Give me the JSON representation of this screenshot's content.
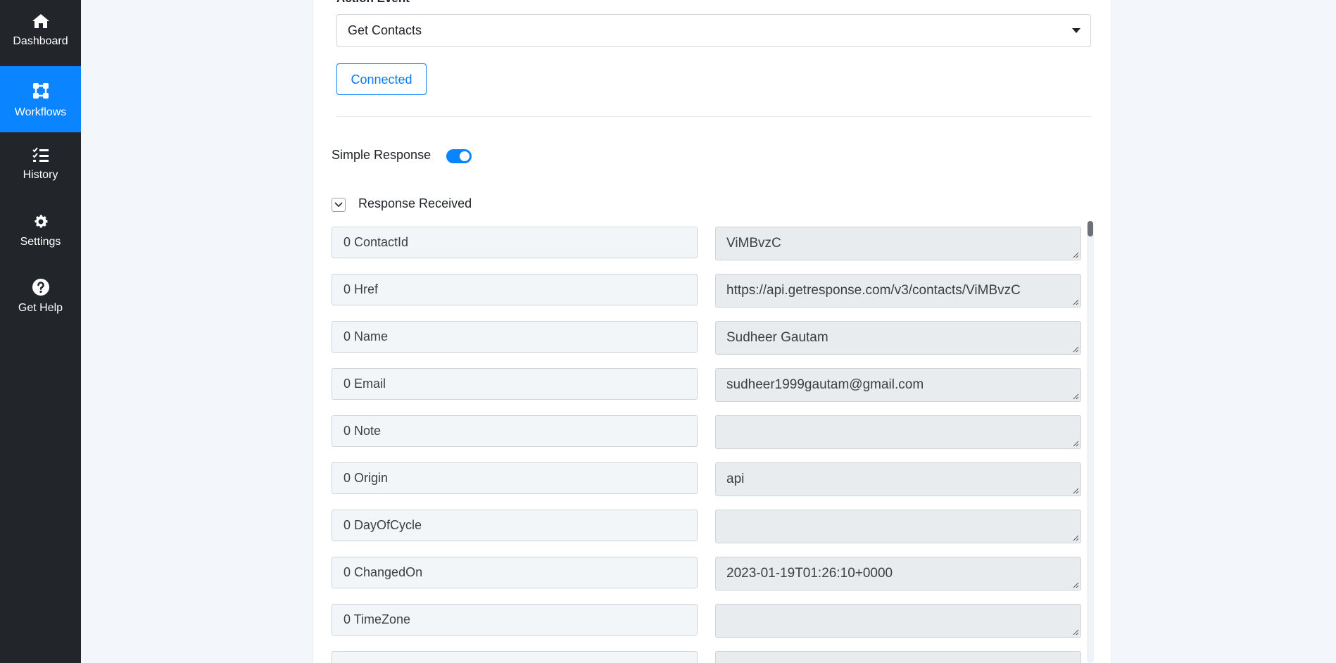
{
  "sidebar": {
    "items": [
      {
        "label": "Dashboard",
        "icon": "home-icon",
        "active": false
      },
      {
        "label": "Workflows",
        "icon": "workflow-icon",
        "active": true
      },
      {
        "label": "History",
        "icon": "checklist-icon",
        "active": false
      },
      {
        "label": "Settings",
        "icon": "gear-icon",
        "active": false
      },
      {
        "label": "Get Help",
        "icon": "question-circle-icon",
        "active": false
      }
    ]
  },
  "form": {
    "action_event_label": "Action Event",
    "action_event_value": "Get Contacts",
    "connected_label": "Connected",
    "simple_response_label": "Simple Response",
    "simple_response_on": true,
    "response_received_label": "Response Received"
  },
  "response": {
    "rows": [
      {
        "key": "0 ContactId",
        "value": "ViMBvzC"
      },
      {
        "key": "0 Href",
        "value": "https://api.getresponse.com/v3/contacts/ViMBvzC"
      },
      {
        "key": "0 Name",
        "value": "Sudheer Gautam"
      },
      {
        "key": "0 Email",
        "value": "sudheer1999gautam@gmail.com"
      },
      {
        "key": "0 Note",
        "value": ""
      },
      {
        "key": "0 Origin",
        "value": "api"
      },
      {
        "key": "0 DayOfCycle",
        "value": ""
      },
      {
        "key": "0 ChangedOn",
        "value": "2023-01-19T01:26:10+0000"
      },
      {
        "key": "0 TimeZone",
        "value": ""
      },
      {
        "key": "",
        "value": ""
      }
    ]
  },
  "colors": {
    "sidebar_bg": "#22262b",
    "accent": "#0a84ff",
    "page_bg": "#f3f7fb"
  }
}
